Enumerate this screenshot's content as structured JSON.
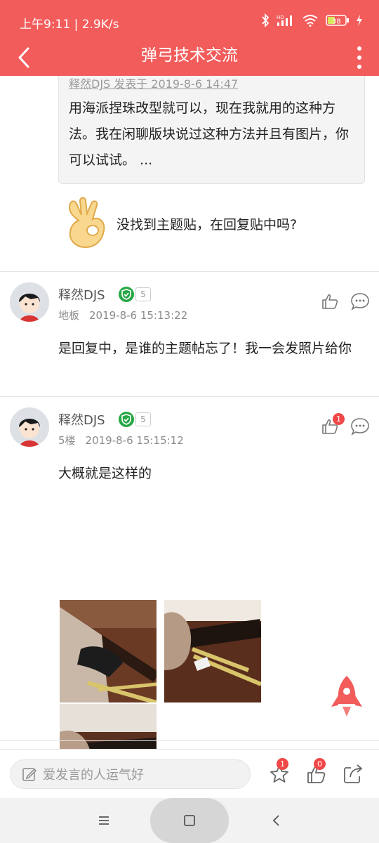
{
  "status_bar": {
    "time_speed": "上午9:11 | 2.9K/s",
    "battery": "38"
  },
  "nav": {
    "title": "弹弓技术交流"
  },
  "quote": {
    "meta": "释然DJS 发表于 2019-8-6 14:47",
    "text": "用海派捏珠改型就可以，现在我就用的这种方法。我在闲聊版块说过这种方法并且有图片，你可以试试。 ..."
  },
  "not_found_text": "没找到主题贴，在回复贴中吗?",
  "posts": [
    {
      "username": "释然DJS",
      "level": "5",
      "floor": "地板",
      "date": "2019-8-6 15:13:22",
      "body": "是回复中，是谁的主题帖忘了！我一会发照片给你"
    },
    {
      "username": "释然DJS",
      "level": "5",
      "floor": "5楼",
      "date": "2019-8-6 15:15:12",
      "body": "大概就是这样的",
      "likes": "1"
    }
  ],
  "bottom_bar": {
    "input_placeholder": "爱发言的人运气好",
    "favorite_count": "1",
    "like_count": "0"
  },
  "colors": {
    "brand": "#f25c5b",
    "badge": "#f04848",
    "shield": "#27a745"
  }
}
